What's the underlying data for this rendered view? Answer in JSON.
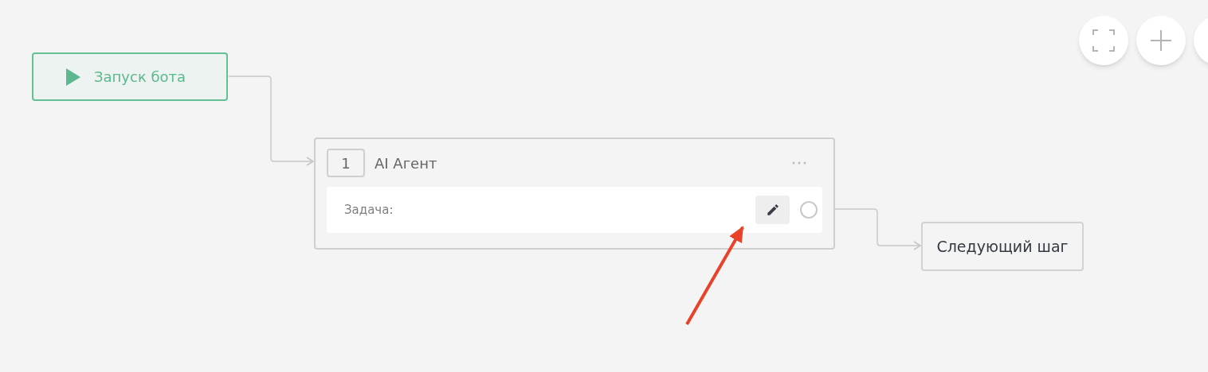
{
  "start_node": {
    "label": "Запуск бота"
  },
  "agent_node": {
    "number": "1",
    "title": "AI Агент",
    "task_label": "Задача:"
  },
  "next_node": {
    "label": "Следующий шаг"
  }
}
